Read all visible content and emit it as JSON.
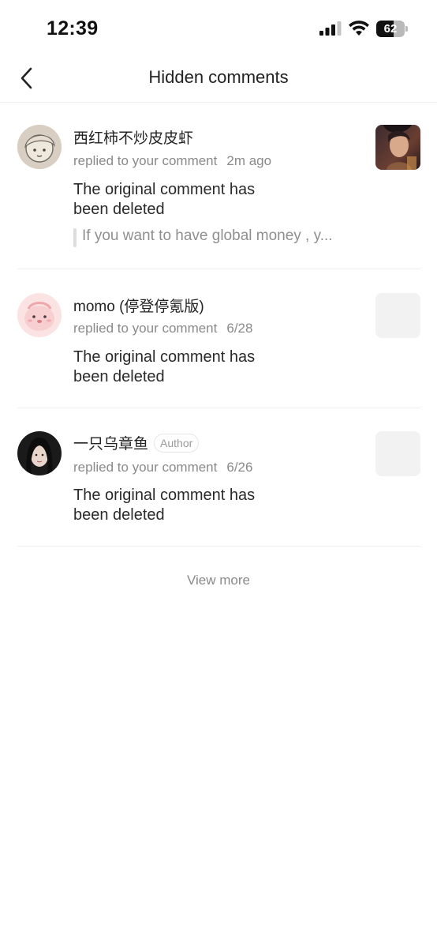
{
  "status_bar": {
    "time": "12:39",
    "battery_level": "62",
    "icons": [
      "signal-icon",
      "wifi-icon",
      "battery-icon"
    ]
  },
  "nav": {
    "back_icon": "chevron-left-icon",
    "title": "Hidden comments"
  },
  "comments": [
    {
      "username": "西红柿不炒皮皮虾",
      "action": "replied to your comment",
      "time": "2m ago",
      "body_line1": "The original comment has",
      "body_line2": "been deleted",
      "quote": "If you want to have global money , y...",
      "has_thumbnail_image": true
    },
    {
      "username": "momo (停登停氪版)",
      "action": "replied to your comment",
      "time": "6/28",
      "body_line1": "The original comment has",
      "body_line2": "been deleted"
    },
    {
      "username": "一只乌章鱼",
      "badge": "Author",
      "action": "replied to your comment",
      "time": "6/26",
      "body_line1": "The original comment has",
      "body_line2": "been deleted"
    }
  ],
  "view_more": "View more",
  "colors": {
    "text_primary": "#222222",
    "text_secondary": "#8a8a8a",
    "divider": "#eeeeee",
    "placeholder": "#f2f2f2"
  }
}
